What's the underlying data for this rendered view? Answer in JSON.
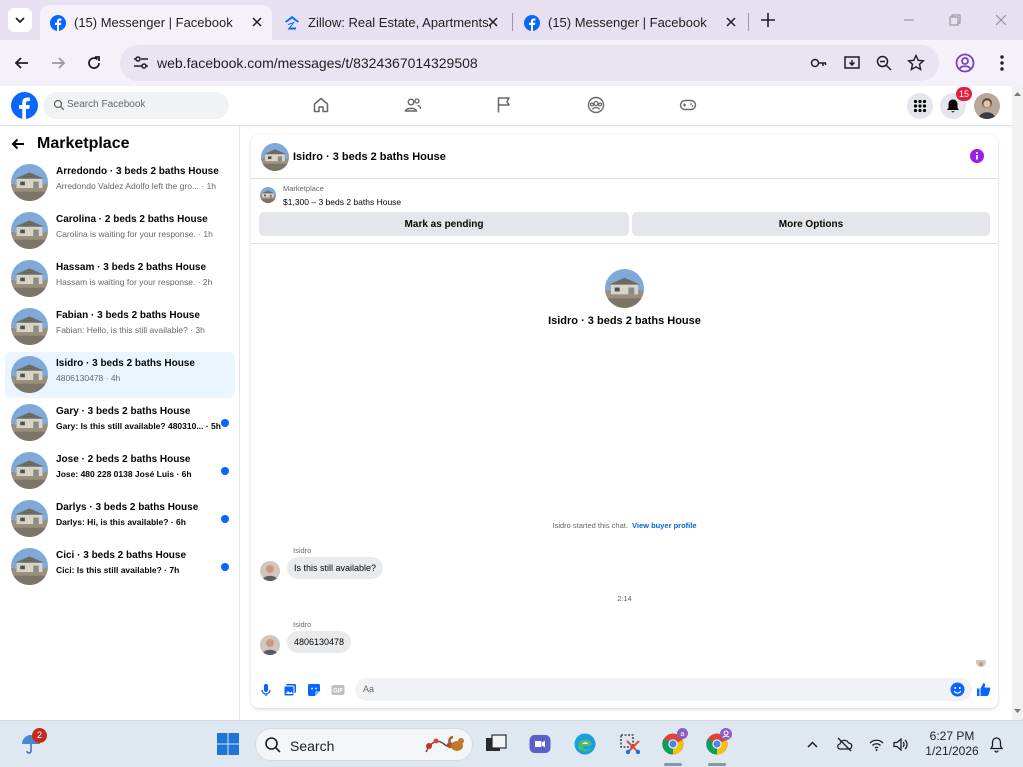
{
  "browser": {
    "tabs": [
      {
        "title": "(15) Messenger | Facebook",
        "favicon": "facebook-icon",
        "active": true
      },
      {
        "title": "Zillow: Real Estate, Apartments,",
        "favicon": "zillow-icon",
        "active": false
      },
      {
        "title": "(15) Messenger | Facebook",
        "favicon": "facebook-icon",
        "active": false
      }
    ],
    "url": "web.facebook.com/messages/t/8324367014329508"
  },
  "header": {
    "search_placeholder": "Search Facebook",
    "nav_icons": [
      "home-icon",
      "friends-icon",
      "pages-flag-icon",
      "groups-icon",
      "gaming-icon"
    ],
    "notification_count": "15",
    "accent": "#0866ff"
  },
  "sidebar": {
    "title": "Marketplace",
    "conversations": [
      {
        "name": "Arredondo · 3 beds 2 baths House",
        "preview": "Arredondo Valdez Adolfo left the gro... · 1h",
        "unread": false,
        "active": false
      },
      {
        "name": "Carolina · 2 beds 2 baths House",
        "preview": "Carolina is waiting for your response. · 1h",
        "unread": false,
        "active": false
      },
      {
        "name": "Hassam · 3 beds 2 baths House",
        "preview": "Hassam is waiting for your response. · 2h",
        "unread": false,
        "active": false
      },
      {
        "name": "Fabian · 3 beds 2 baths House",
        "preview": "Fabian: Hello, is this still available? · 3h",
        "unread": false,
        "active": false
      },
      {
        "name": "Isidro · 3 beds 2 baths House",
        "preview": "4806130478 · 4h",
        "unread": false,
        "active": true
      },
      {
        "name": "Gary · 3 beds 2 baths House",
        "preview": "Gary: Is this still available? 480310... · 5h",
        "unread": true,
        "active": false
      },
      {
        "name": "Jose · 2 beds 2 baths House",
        "preview": "Jose: 480 228 0138 José Luis · 6h",
        "unread": true,
        "active": false
      },
      {
        "name": "Darlys · 3 beds 2 baths House",
        "preview": "Darlys: Hi, is this available? · 6h",
        "unread": true,
        "active": false
      },
      {
        "name": "Cici · 3 beds 2 baths House",
        "preview": "Cici: Is this still available? · 7h",
        "unread": true,
        "active": false
      }
    ]
  },
  "chat": {
    "title": "Isidro · 3 beds 2 baths House",
    "listing": {
      "category": "Marketplace",
      "price_line": "$1,300 – 3 beds 2 baths House",
      "mark_pending": "Mark as pending",
      "more_options": "More Options"
    },
    "profile_name": "Isidro · 3 beds 2 baths House",
    "system_message": "Isidro started this chat.",
    "system_link": "View buyer profile",
    "messages": [
      {
        "sender": "Isidro",
        "text": "Is this still available?"
      },
      {
        "sender": "Isidro",
        "text": "4806130478"
      }
    ],
    "timestamp": "2:14",
    "composer_placeholder": "Aa"
  },
  "taskbar": {
    "weather_badge": "2",
    "search_label": "Search",
    "time": "6:27 PM",
    "date": "1/21/2026"
  }
}
